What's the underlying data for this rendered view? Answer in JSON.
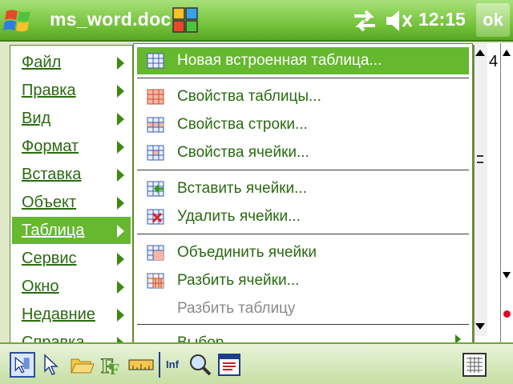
{
  "titlebar": {
    "title": "ms_word.doc",
    "time": "12:15",
    "ok_label": "ok"
  },
  "document": {
    "ruler_fragment": "4"
  },
  "main_menu": {
    "items": [
      {
        "label": "Файл",
        "has_submenu": true
      },
      {
        "label": "Правка",
        "has_submenu": true
      },
      {
        "label": "Вид",
        "has_submenu": true
      },
      {
        "label": "Формат",
        "has_submenu": true
      },
      {
        "label": "Вставка",
        "has_submenu": true
      },
      {
        "label": "Объект",
        "has_submenu": true
      },
      {
        "label": "Таблица",
        "has_submenu": true,
        "active": true
      },
      {
        "label": "Сервис",
        "has_submenu": true
      },
      {
        "label": "Окно",
        "has_submenu": true
      },
      {
        "label": "Недавние",
        "has_submenu": true
      },
      {
        "label": "Справка",
        "has_submenu": true
      }
    ]
  },
  "table_submenu": {
    "items": [
      {
        "label": "Новая встроенная таблица...",
        "icon": "table-grid-icon",
        "active": true
      },
      {
        "label": "Свойства таблицы...",
        "icon": "table-properties-icon"
      },
      {
        "label": "Свойства строки...",
        "icon": "row-properties-icon"
      },
      {
        "label": "Свойства ячейки...",
        "icon": "cell-properties-icon"
      },
      {
        "label": "Вставить ячейки...",
        "icon": "insert-cells-icon"
      },
      {
        "label": "Удалить ячейки...",
        "icon": "delete-cells-icon"
      },
      {
        "label": "Объединить ячейки",
        "icon": "merge-cells-icon"
      },
      {
        "label": "Разбить ячейки...",
        "icon": "split-cells-icon"
      },
      {
        "label": "Разбить таблицу",
        "disabled": true
      },
      {
        "label": "Выбор",
        "has_submenu": true
      }
    ]
  },
  "toolbar": {
    "icons": [
      "select-pointer-icon",
      "pointer-icon",
      "open-folder-icon",
      "font-icon",
      "ruler-icon",
      "inf-icon",
      "zoom-icon",
      "view-icon",
      "keyboard-icon"
    ],
    "inf_label": "Inf"
  },
  "colors": {
    "accent": "#66b82e",
    "menu_text": "#2b6a12",
    "titlebar": "#6fbd35"
  }
}
